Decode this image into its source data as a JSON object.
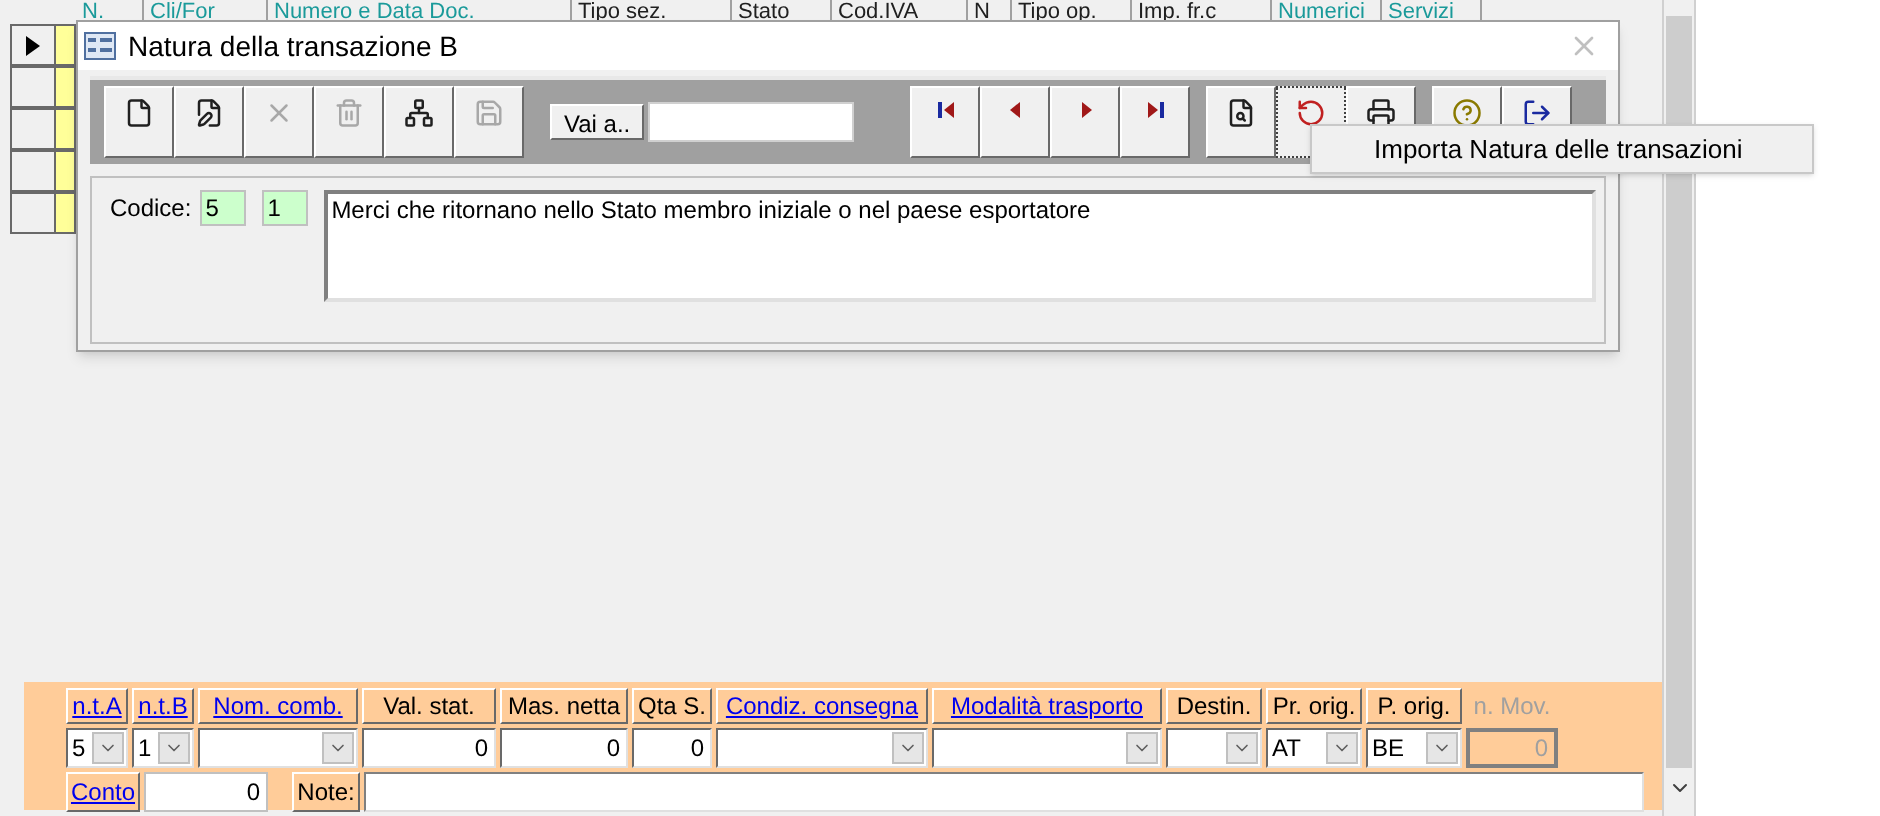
{
  "grid": {
    "columns": [
      {
        "label": "N.",
        "link": true
      },
      {
        "label": "Cli/For",
        "link": true
      },
      {
        "label": "Numero e Data Doc.",
        "link": true
      },
      {
        "label": "Tipo sez.",
        "link": false
      },
      {
        "label": "Stato",
        "link": false
      },
      {
        "label": "Cod.IVA",
        "link": false
      },
      {
        "label": "N",
        "link": false
      },
      {
        "label": "Tipo op.",
        "link": false
      },
      {
        "label": "Imp. fr.c",
        "link": false
      },
      {
        "label": "Numerici",
        "link": true
      },
      {
        "label": "Servizi",
        "link": true
      }
    ],
    "rows": [
      {
        "selected": true
      },
      {
        "selected": false
      },
      {
        "selected": false
      },
      {
        "selected": false
      },
      {
        "selected": false
      }
    ]
  },
  "dialog": {
    "title": "Natura della transazione B",
    "toolbar": [
      [
        {
          "kind": "new",
          "disabled": false,
          "focused": false
        },
        {
          "kind": "edit",
          "disabled": false,
          "focused": false
        },
        {
          "kind": "cancel",
          "disabled": true,
          "focused": false
        },
        {
          "kind": "delete",
          "disabled": true,
          "focused": false
        },
        {
          "kind": "tree",
          "disabled": false,
          "focused": false
        },
        {
          "kind": "save",
          "disabled": true,
          "focused": false
        }
      ],
      [
        {
          "kind": "first",
          "disabled": false,
          "focused": false
        },
        {
          "kind": "prev",
          "disabled": false,
          "focused": false
        },
        {
          "kind": "next",
          "disabled": false,
          "focused": false
        },
        {
          "kind": "last",
          "disabled": false,
          "focused": false
        }
      ],
      [
        {
          "kind": "preview",
          "disabled": false,
          "focused": false
        },
        {
          "kind": "import",
          "disabled": false,
          "focused": true
        },
        {
          "kind": "print",
          "disabled": false,
          "focused": false
        }
      ],
      [
        {
          "kind": "help",
          "disabled": false,
          "focused": false
        },
        {
          "kind": "exit",
          "disabled": false,
          "focused": false
        }
      ]
    ],
    "goto": {
      "label": "Vai a.."
    },
    "form": {
      "label": "Codice:",
      "code_a": "5",
      "code_b": "1",
      "description": "Merci che ritornano nello Stato membro iniziale o nel paese esportatore"
    },
    "popup_menu": {
      "item": "Importa Natura delle transazioni"
    }
  },
  "bottom_panel": {
    "columns": [
      {
        "label": "n.t.A",
        "kind": "link",
        "field": {
          "kind": "combo",
          "value": "5"
        }
      },
      {
        "label": "n.t.B",
        "kind": "link",
        "field": {
          "kind": "combo",
          "value": "1"
        }
      },
      {
        "label": "Nom. comb.",
        "kind": "link",
        "field": {
          "kind": "combo"
        }
      },
      {
        "label": "Val. stat.",
        "kind": "plain",
        "field": {
          "kind": "number",
          "value": "0",
          "disabled": false
        }
      },
      {
        "label": "Mas. netta",
        "kind": "plain",
        "field": {
          "kind": "number",
          "value": "0",
          "disabled": false
        }
      },
      {
        "label": "Qta S.",
        "kind": "plain",
        "field": {
          "kind": "number",
          "value": "0",
          "disabled": false
        }
      },
      {
        "label": "Condiz. consegna",
        "kind": "link",
        "field": {
          "kind": "combo"
        }
      },
      {
        "label": "Modalità trasporto",
        "kind": "link",
        "field": {
          "kind": "combo"
        }
      },
      {
        "label": "Destin.",
        "kind": "plain",
        "field": {
          "kind": "combo"
        }
      },
      {
        "label": "Pr. orig.",
        "kind": "plain",
        "field": {
          "kind": "combo",
          "value": "AT"
        }
      },
      {
        "label": "P. orig.",
        "kind": "plain",
        "field": {
          "kind": "combo",
          "value": "BE"
        }
      },
      {
        "label": "n. Mov.",
        "kind": "disabled",
        "field": {
          "kind": "number",
          "value": "0",
          "disabled": true
        }
      }
    ],
    "conto": {
      "label": "Conto",
      "value": "0"
    },
    "note": {
      "label": "Note:"
    }
  }
}
